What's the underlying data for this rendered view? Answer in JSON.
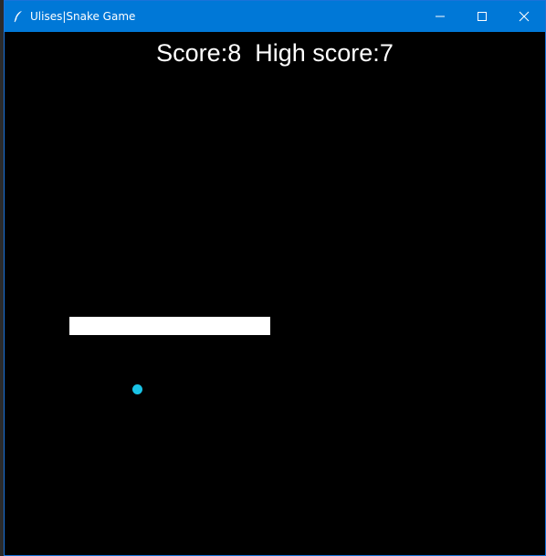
{
  "window": {
    "title": "Ulises|Snake Game",
    "icon": "feather-icon",
    "controls": [
      "minimize-icon",
      "maximize-icon",
      "close-icon"
    ]
  },
  "game": {
    "score_label": "Score:",
    "score": 8,
    "high_score_label": "High score:",
    "high_score": 7,
    "snake_segments": 11,
    "food_color": "#19c3e6",
    "snake_color": "#ffffff",
    "background_color": "#000000"
  },
  "colors": {
    "titlebar": "#0078d7"
  }
}
